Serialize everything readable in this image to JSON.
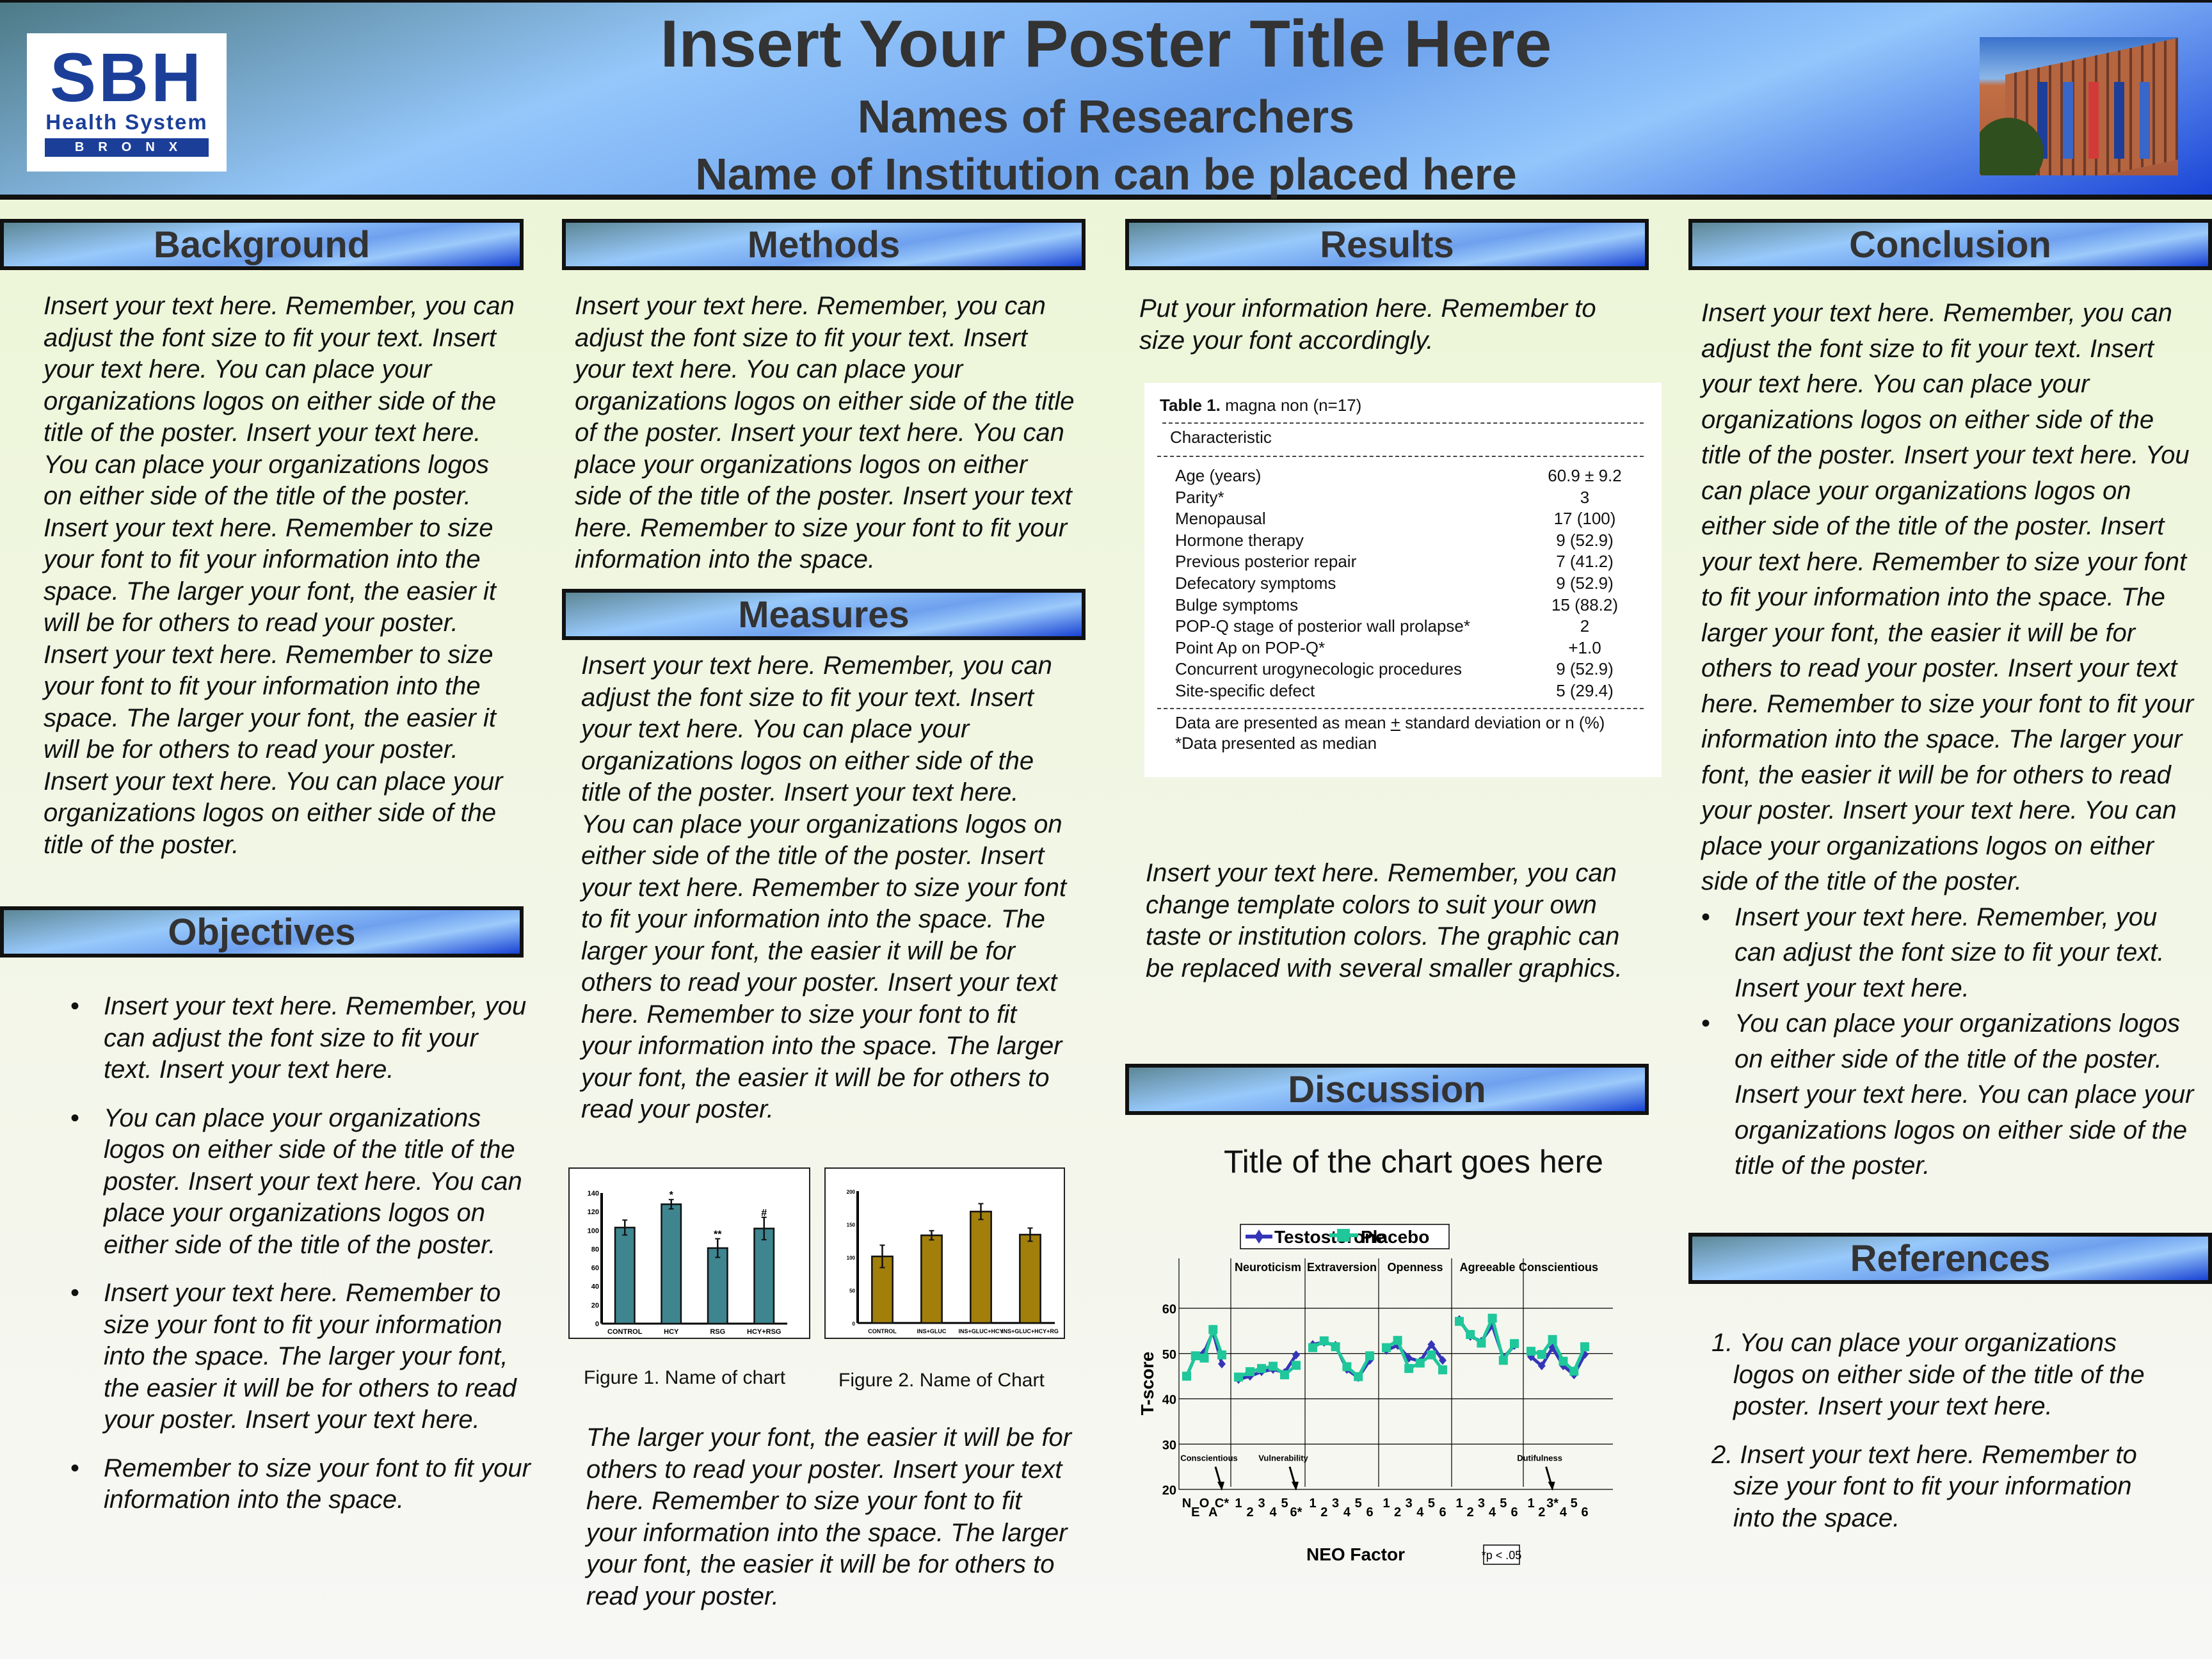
{
  "header": {
    "title": "Insert Your Poster Title Here",
    "researchers": "Names of Researchers",
    "institution": "Name of Institution can be placed here",
    "logo": {
      "main": "SBH",
      "sub": "Health System",
      "band": "BRONX",
      "color": "#1b3f99"
    },
    "photo_icon": "building-photo"
  },
  "sections": {
    "background": {
      "heading": "Background",
      "text": "Insert your text here. Remember, you can adjust the font size to fit your text. Insert your text here. You can place your organizations logos on either side of the title of the poster. Insert your text here. You can place your organizations logos on either side of the title of the poster. Insert your text here. Remember to size your font to fit your information into the space. The larger your font, the easier it will be for others to read your poster. Insert your text here. Remember to size your font to fit your information into the space. The larger your font, the easier it will be for others to read your poster. Insert your text here. You can place your organizations logos on either side of the title of the poster."
    },
    "objectives": {
      "heading": "Objectives",
      "bullets": [
        "Insert your text here. Remember, you can adjust the font size to fit your text. Insert your text here.",
        "You can place your organizations logos on either side of the title of the poster. Insert your text here. You can place your organizations logos on either side of the title of the poster.",
        "Insert your text here. Remember to size your font to fit your information into the space. The larger your font, the easier it will be for others to read your poster. Insert your text here.",
        "Remember to size your font to fit your information into the space."
      ]
    },
    "methods": {
      "heading": "Methods",
      "text": "Insert your text here. Remember, you can adjust the font size to fit your text. Insert your text here. You can place your organizations logos on either side of the title of the poster. Insert your text here. You can place your organizations logos on either side of the title of the poster. Insert your text here. Remember to size your font to fit your information into the space."
    },
    "measures": {
      "heading": "Measures",
      "text": "Insert your text here. Remember, you can adjust the font size to fit your text. Insert your text here. You can place your organizations logos on either side of the title of the poster. Insert your text here. You can place your organizations logos on either side of the title of the poster. Insert your text here. Remember to size your font to fit your information into the space. The larger your font, the easier it will be for others to read your poster. Insert your text here. Remember to size your font to fit your information into the space. The larger your font, the easier it will be for others to read your poster.",
      "after_figures": "The larger your font, the easier it will be for others to read your poster. Insert your text here. Remember to size your font to fit your information into the space. The larger your font, the easier it will be for others to read your poster."
    },
    "results": {
      "heading": "Results",
      "intro": "Put your information here. Remember to size your font accordingly.",
      "after_table": "Insert your text here. Remember, you can change template colors to suit your own taste or institution colors. The graphic can be replaced with several smaller graphics."
    },
    "discussion": {
      "heading": "Discussion"
    },
    "conclusion": {
      "heading": "Conclusion",
      "text": "Insert your text here. Remember, you can adjust the font size to fit your text. Insert your text here. You can place your organizations logos on either side of the title of the poster. Insert your text here. You can place your organizations logos on either side of the title of the poster. Insert your text here. Remember to size your font to fit your information into the space. The larger your font, the easier it will be for others to read your poster. Insert your text here. Remember to size your font to fit your information into the space. The larger your font, the easier it will be for others to read your poster. Insert your text here. You can place your organizations logos on either side of the title of the poster.",
      "bullets": [
        "Insert your text here. Remember, you can adjust the font size to fit your text. Insert your text here.",
        "You can place your organizations logos on either side of the title of the poster. Insert your text here. You can place your organizations logos on either side of the title of the poster."
      ]
    },
    "references": {
      "heading": "References",
      "items": [
        "1. You can place your organizations logos on either side of the title of the poster. Insert your text here.",
        "2. Insert your text here. Remember to size your font to fit your information into the space."
      ]
    }
  },
  "table1": {
    "title_bold": "Table 1.",
    "title_rest": " magna non (n=17)",
    "column_header": "Characteristic",
    "rows": [
      {
        "label": "Age (years)",
        "value": "60.9 ± 9.2"
      },
      {
        "label": "Parity*",
        "value": "3"
      },
      {
        "label": "Menopausal",
        "value": "17 (100)"
      },
      {
        "label": "Hormone therapy",
        "value": "9 (52.9)"
      },
      {
        "label": "Previous posterior repair",
        "value": "7 (41.2)"
      },
      {
        "label": "Defecatory symptoms",
        "value": "9 (52.9)"
      },
      {
        "label": "Bulge symptoms",
        "value": "15 (88.2)"
      },
      {
        "label": "POP-Q stage of posterior wall prolapse*",
        "value": "2"
      },
      {
        "label": "Point Ap on POP-Q*",
        "value": "+1.0"
      },
      {
        "label": "Concurrent urogynecologic procedures",
        "value": "9 (52.9)"
      },
      {
        "label": "Site-specific defect",
        "value": "5 (29.4)"
      }
    ],
    "footnote1": "Data are presented as mean ± standard deviation or n (%)",
    "footnote2": "*Data presented as median"
  },
  "chart_data": [
    {
      "id": "figure1",
      "type": "bar",
      "caption": "Figure 1. Name of chart",
      "categories": [
        "CONTROL",
        "HCY",
        "RSG",
        "HCY+RSG"
      ],
      "values": [
        103,
        128,
        81,
        102
      ],
      "errors": [
        8,
        5,
        10,
        12
      ],
      "annotations": [
        "",
        "*",
        "**",
        "#"
      ],
      "yticks": [
        0,
        20,
        40,
        60,
        80,
        100,
        120,
        140
      ],
      "ylim": [
        0,
        140
      ],
      "color": "#3e8590",
      "xlabel": "",
      "ylabel": "",
      "title": ""
    },
    {
      "id": "figure2",
      "type": "bar",
      "caption": "Figure 2. Name of Chart",
      "categories": [
        "CONTROL",
        "INS+GLUC",
        "INS+GLUC+HCY",
        "INS+GLUC+HCY+RG"
      ],
      "values": [
        101,
        133,
        169,
        134
      ],
      "errors": [
        17,
        7,
        12,
        10
      ],
      "yticks": [
        0,
        50,
        100,
        150,
        200
      ],
      "ylim": [
        0,
        200
      ],
      "color": "#a27f0b",
      "xlabel": "",
      "ylabel": "",
      "title": ""
    },
    {
      "id": "neo-chart",
      "type": "line",
      "title": "Title of the chart goes here",
      "xlabel": "NEO Factor",
      "ylabel": "T-score",
      "ylim": [
        20,
        60
      ],
      "yticks": [
        20,
        30,
        40,
        50,
        60
      ],
      "grid": true,
      "legend": {
        "position": "top",
        "entries": [
          "Testosterone",
          "Placebo"
        ]
      },
      "groups": [
        {
          "name": "",
          "ticks": [
            "N",
            "E",
            "O",
            "A",
            "C*"
          ]
        },
        {
          "name": "Neuroticism",
          "ticks": [
            "1",
            "2",
            "3",
            "4",
            "5",
            "6*"
          ]
        },
        {
          "name": "Extraversion",
          "ticks": [
            "1",
            "2",
            "3",
            "4",
            "5",
            "6"
          ]
        },
        {
          "name": "Openness",
          "ticks": [
            "1",
            "2",
            "3",
            "4",
            "5",
            "6"
          ]
        },
        {
          "name": "Agreeable",
          "ticks": [
            "1",
            "2",
            "3",
            "4",
            "5",
            "6"
          ]
        },
        {
          "name": "Conscientious",
          "ticks": [
            "1",
            "2",
            "3*",
            "4",
            "5",
            "6"
          ]
        }
      ],
      "series": [
        {
          "name": "Testosterone",
          "color": "#3535b8",
          "marker": "diamond",
          "groups": [
            [
              45,
              49.5,
              50.3,
              54.8,
              47.7
            ],
            [
              44.3,
              45,
              46,
              46.5,
              45.8,
              49.7
            ],
            [
              52,
              52.5,
              51.8,
              46.5,
              44.7,
              48.5
            ],
            [
              50.7,
              51.8,
              49,
              48.3,
              52,
              48.5
            ],
            [
              57.5,
              53.8,
              52.7,
              56.2,
              49,
              51.8
            ],
            [
              49.3,
              47.3,
              51.3,
              47.3,
              45.3,
              49.8
            ]
          ]
        },
        {
          "name": "Placebo",
          "color": "#1fc79a",
          "marker": "square",
          "groups": [
            [
              45,
              49.5,
              49,
              55.3,
              49.7
            ],
            [
              44.8,
              46,
              46.7,
              47.2,
              45.3,
              47.4
            ],
            [
              51.3,
              52.8,
              51.5,
              47.1,
              44.9,
              49.5
            ],
            [
              51.3,
              52.9,
              46.7,
              47.9,
              49.7,
              46.4
            ],
            [
              57.1,
              54.2,
              52.3,
              57.8,
              48.5,
              52.2
            ],
            [
              50.5,
              49.8,
              53.1,
              48.3,
              46.1,
              51.5
            ]
          ]
        }
      ],
      "annotations": [
        {
          "text": "Conscientious",
          "group": 0,
          "tick": 4
        },
        {
          "text": "Vulnerability",
          "group": 1,
          "tick": 5
        },
        {
          "text": "Dutifulness",
          "group": 5,
          "tick": 2
        }
      ],
      "note": "*p < .05"
    }
  ]
}
